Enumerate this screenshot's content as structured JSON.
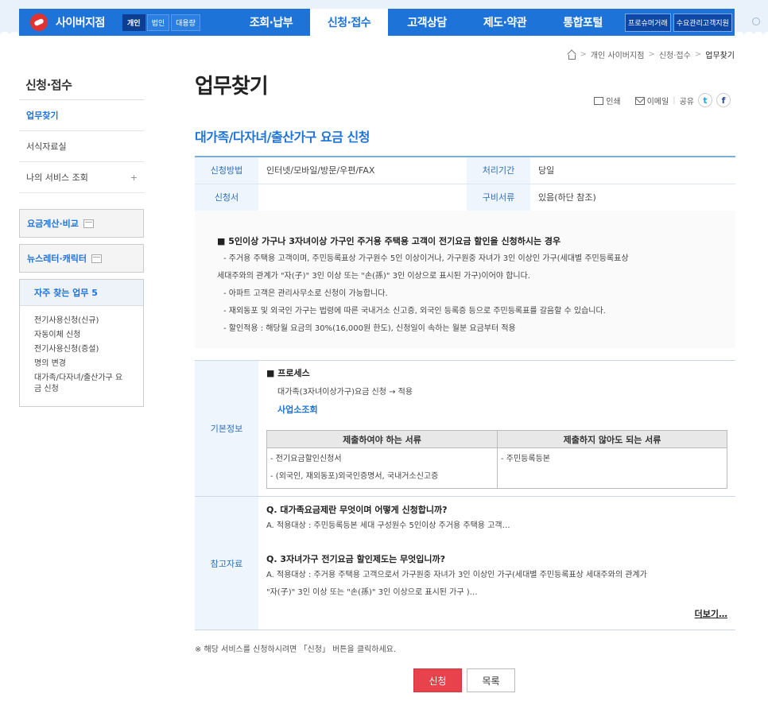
{
  "header": {
    "logo": "사이버지점",
    "segments": [
      "개인",
      "법인",
      "대용량"
    ],
    "menu": [
      "조회·납부",
      "신청·접수",
      "고객상담",
      "제도·약관",
      "통합포털"
    ],
    "extra": [
      "프로슈머거래",
      "수요관리고객지원"
    ]
  },
  "breadcrumb": {
    "items": [
      "개인 사이버지점",
      "신청·접수",
      "업무찾기"
    ]
  },
  "sidebar": {
    "title": "신청·접수",
    "items": [
      {
        "label": "업무찾기"
      },
      {
        "label": "서식자료실"
      },
      {
        "label": "나의 서비스 조회",
        "suffix": "+"
      }
    ],
    "boxes": [
      "요금계산·비교",
      "뉴스레터·캐릭터"
    ],
    "faq": {
      "title": "자주 찾는 업무 5",
      "items": [
        "전기사용신청(신규)",
        "자동이체 신청",
        "전기사용신청(증설)",
        "명의 변경",
        "대가족/다자녀/출산가구 요금 신청"
      ]
    }
  },
  "page": {
    "title": "업무찾기",
    "tools": {
      "print": "인쇄",
      "email": "이메일",
      "share": "공유"
    },
    "subtitle": "대가족/다자녀/출산가구 요금 신청"
  },
  "info": {
    "method_label": "신청방법",
    "method_value": "인터넷/모바일/방문/우편/FAX",
    "period_label": "처리기간",
    "period_value": "당일",
    "form_label": "신청서",
    "form_value": "",
    "docs_label": "구비서류",
    "docs_value": "있음(하단 참조)"
  },
  "notice": {
    "title": "■ 5인이상 가구나 3자녀이상 가구인 주거용 주택용 고객이 전기요금 할인을 신청하시는 경우",
    "lines": [
      "- 주거용 주택용 고객이며, 주민등록표상 가구원수 5인 이상이거나, 가구원중 자녀가 3인 이상인 가구(세대별 주민등록표상",
      "세대주와의 관계가 \"자(子)\" 3인 이상 또는 \"손(孫)\" 3인 이상으로 표시된 가구)이어야 합니다.",
      "- 아파트 고객은 관리사무소로 신청이 가능합니다.",
      "- 재외동포 및 외국인 가구는 법령에 따른 국내거소 신고증, 외국인 등록증 등으로 주민등록표를 갈음할 수 있습니다.",
      "- 할인적용 : 해당월 요금의 30%(16,000원 한도), 신청일이 속하는 월분 요금부터 적용"
    ]
  },
  "basic": {
    "label": "기본정보",
    "process_title": "■ 프로세스",
    "process_flow": "대가족(3자녀이상가구)요금 신청 → 적용",
    "business_link": "사업소조회",
    "docs_required_header": "제출하여야 하는 서류",
    "docs_optional_header": "제출하지 않아도 되는 서류",
    "docs_required": [
      "- 전기요금할인신청서",
      "- (외국인, 재외동포)외국인증명서, 국내거소신고증"
    ],
    "docs_optional": [
      "- 주민등록등본"
    ]
  },
  "reference": {
    "label": "참고자료",
    "q1": "Q. 대가족요금제란 무엇이며 어떻게 신청합니까?",
    "a1": "A. 적용대상 :  주민등록등본 세대 구성원수 5인이상 주거용 주택용 고객…",
    "q2": "Q. 3자녀가구 전기요금 할인제도는 무엇입니까?",
    "a2_1": "A. 적용대상 : 주거용 주택용 고객으로서 가구원중 자녀가 3인 이상인 가구(세대별 주민등록표상 세대주와의 관계가",
    "a2_2": "\"자(子)\" 3인 이상 또는 \"손(孫)\" 3인 이상으로 표시된 가구 )…",
    "more": "더보기…"
  },
  "footer": {
    "note": "※ 해당 서비스를 신청하시려면 「신청」 버튼을 클릭하세요.",
    "apply": "신청",
    "list": "목록"
  },
  "colors": {
    "brand": "#1e73d8",
    "apply_button": "#e8424c"
  }
}
